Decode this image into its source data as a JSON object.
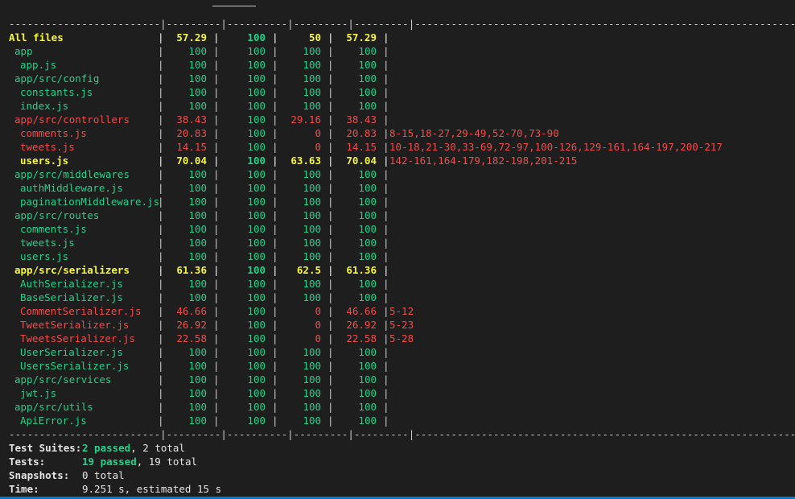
{
  "separator_line": "-------------------------|---------|----------|---------|---------|-------------------------------------------------------------------",
  "rows": [
    {
      "file": "All files",
      "indent": 0,
      "stmts": "57.29",
      "branch": "100",
      "funcs": "50",
      "lines": "57.29",
      "uncovered": "",
      "color": "y",
      "bold": true
    },
    {
      "file": "app",
      "indent": 1,
      "stmts": "100",
      "branch": "100",
      "funcs": "100",
      "lines": "100",
      "uncovered": "",
      "color": "g",
      "bold": false
    },
    {
      "file": "app.js",
      "indent": 2,
      "stmts": "100",
      "branch": "100",
      "funcs": "100",
      "lines": "100",
      "uncovered": "",
      "color": "g",
      "bold": false
    },
    {
      "file": "app/src/config",
      "indent": 1,
      "stmts": "100",
      "branch": "100",
      "funcs": "100",
      "lines": "100",
      "uncovered": "",
      "color": "g",
      "bold": false
    },
    {
      "file": "constants.js",
      "indent": 2,
      "stmts": "100",
      "branch": "100",
      "funcs": "100",
      "lines": "100",
      "uncovered": "",
      "color": "g",
      "bold": false
    },
    {
      "file": "index.js",
      "indent": 2,
      "stmts": "100",
      "branch": "100",
      "funcs": "100",
      "lines": "100",
      "uncovered": "",
      "color": "g",
      "bold": false
    },
    {
      "file": "app/src/controllers",
      "indent": 1,
      "stmts": "38.43",
      "branch": "100",
      "funcs": "29.16",
      "lines": "38.43",
      "uncovered": "",
      "color": "r",
      "bold": false
    },
    {
      "file": "comments.js",
      "indent": 2,
      "stmts": "20.83",
      "branch": "100",
      "funcs": "0",
      "lines": "20.83",
      "uncovered": "8-15,18-27,29-49,52-70,73-90",
      "color": "r",
      "bold": false
    },
    {
      "file": "tweets.js",
      "indent": 2,
      "stmts": "14.15",
      "branch": "100",
      "funcs": "0",
      "lines": "14.15",
      "uncovered": "10-18,21-30,33-69,72-97,100-126,129-161,164-197,200-217",
      "color": "r",
      "bold": false
    },
    {
      "file": "users.js",
      "indent": 2,
      "stmts": "70.04",
      "branch": "100",
      "funcs": "63.63",
      "lines": "70.04",
      "uncovered": "142-161,164-179,182-198,201-215",
      "color": "y",
      "bold": true
    },
    {
      "file": "app/src/middlewares",
      "indent": 1,
      "stmts": "100",
      "branch": "100",
      "funcs": "100",
      "lines": "100",
      "uncovered": "",
      "color": "g",
      "bold": false
    },
    {
      "file": "authMiddleware.js",
      "indent": 2,
      "stmts": "100",
      "branch": "100",
      "funcs": "100",
      "lines": "100",
      "uncovered": "",
      "color": "g",
      "bold": false
    },
    {
      "file": "paginationMiddleware.js",
      "indent": 2,
      "stmts": "100",
      "branch": "100",
      "funcs": "100",
      "lines": "100",
      "uncovered": "",
      "color": "g",
      "bold": false
    },
    {
      "file": "app/src/routes",
      "indent": 1,
      "stmts": "100",
      "branch": "100",
      "funcs": "100",
      "lines": "100",
      "uncovered": "",
      "color": "g",
      "bold": false
    },
    {
      "file": "comments.js",
      "indent": 2,
      "stmts": "100",
      "branch": "100",
      "funcs": "100",
      "lines": "100",
      "uncovered": "",
      "color": "g",
      "bold": false
    },
    {
      "file": "tweets.js",
      "indent": 2,
      "stmts": "100",
      "branch": "100",
      "funcs": "100",
      "lines": "100",
      "uncovered": "",
      "color": "g",
      "bold": false
    },
    {
      "file": "users.js",
      "indent": 2,
      "stmts": "100",
      "branch": "100",
      "funcs": "100",
      "lines": "100",
      "uncovered": "",
      "color": "g",
      "bold": false
    },
    {
      "file": "app/src/serializers",
      "indent": 1,
      "stmts": "61.36",
      "branch": "100",
      "funcs": "62.5",
      "lines": "61.36",
      "uncovered": "",
      "color": "y",
      "bold": true
    },
    {
      "file": "AuthSerializer.js",
      "indent": 2,
      "stmts": "100",
      "branch": "100",
      "funcs": "100",
      "lines": "100",
      "uncovered": "",
      "color": "g",
      "bold": false
    },
    {
      "file": "BaseSerializer.js",
      "indent": 2,
      "stmts": "100",
      "branch": "100",
      "funcs": "100",
      "lines": "100",
      "uncovered": "",
      "color": "g",
      "bold": false
    },
    {
      "file": "CommentSerializer.js",
      "indent": 2,
      "stmts": "46.66",
      "branch": "100",
      "funcs": "0",
      "lines": "46.66",
      "uncovered": "5-12",
      "color": "r",
      "bold": false
    },
    {
      "file": "TweetSerializer.js",
      "indent": 2,
      "stmts": "26.92",
      "branch": "100",
      "funcs": "0",
      "lines": "26.92",
      "uncovered": "5-23",
      "color": "r",
      "bold": false
    },
    {
      "file": "TweetsSerializer.js",
      "indent": 2,
      "stmts": "22.58",
      "branch": "100",
      "funcs": "0",
      "lines": "22.58",
      "uncovered": "5-28",
      "color": "r",
      "bold": false
    },
    {
      "file": "UserSerializer.js",
      "indent": 2,
      "stmts": "100",
      "branch": "100",
      "funcs": "100",
      "lines": "100",
      "uncovered": "",
      "color": "g",
      "bold": false
    },
    {
      "file": "UsersSerializer.js",
      "indent": 2,
      "stmts": "100",
      "branch": "100",
      "funcs": "100",
      "lines": "100",
      "uncovered": "",
      "color": "g",
      "bold": false
    },
    {
      "file": "app/src/services",
      "indent": 1,
      "stmts": "100",
      "branch": "100",
      "funcs": "100",
      "lines": "100",
      "uncovered": "",
      "color": "g",
      "bold": false
    },
    {
      "file": "jwt.js",
      "indent": 2,
      "stmts": "100",
      "branch": "100",
      "funcs": "100",
      "lines": "100",
      "uncovered": "",
      "color": "g",
      "bold": false
    },
    {
      "file": "app/src/utils",
      "indent": 1,
      "stmts": "100",
      "branch": "100",
      "funcs": "100",
      "lines": "100",
      "uncovered": "",
      "color": "g",
      "bold": false
    },
    {
      "file": "ApiError.js",
      "indent": 2,
      "stmts": "100",
      "branch": "100",
      "funcs": "100",
      "lines": "100",
      "uncovered": "",
      "color": "g",
      "bold": false
    }
  ],
  "summary": {
    "suites_label": "Test Suites:",
    "suites_passed": "2 passed",
    "suites_total": ", 2 total",
    "tests_label": "Tests:",
    "tests_passed": "19 passed",
    "tests_total": ", 19 total",
    "snapshots_label": "Snapshots:",
    "snapshots_value": "0 total",
    "time_label": "Time:",
    "time_value": "9.251 s, estimated 15 s"
  },
  "colors": {
    "background": "#1e1e1e",
    "green": "#23d18b",
    "red": "#f14c4c",
    "yellow": "#f5f543",
    "accent": "#007acc"
  }
}
